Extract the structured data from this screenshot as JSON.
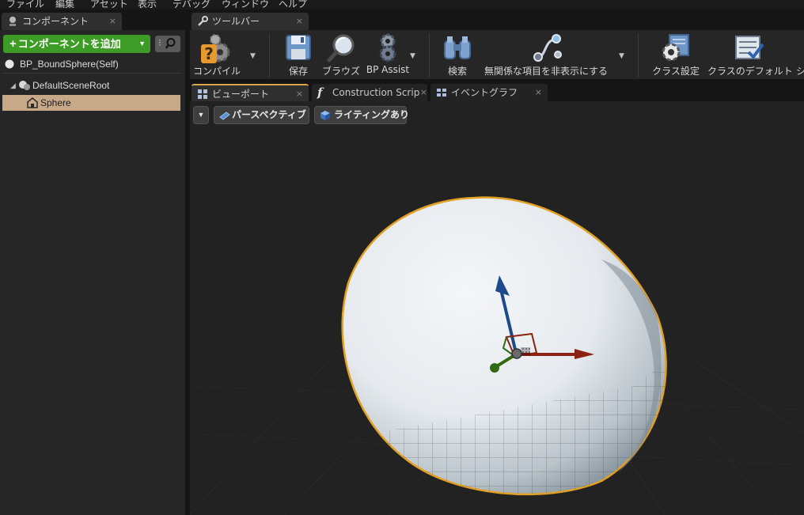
{
  "menu": [
    "ファイル",
    "編集",
    "アセット",
    "表示",
    "デバッグ",
    "ウィンドウ",
    "ヘルプ"
  ],
  "components_panel": {
    "tab_title": "コンポーネント",
    "tab_close": "×",
    "add_button_label": "コンポーネントを追加",
    "add_button_plus": "+",
    "tree": {
      "self": "BP_BoundSphere(Self)",
      "root": "DefaultSceneRoot",
      "sphere": "Sphere"
    }
  },
  "toolbar_panel": {
    "tab_title": "ツールバー",
    "tab_close": "×",
    "buttons": {
      "compile": "コンパイル",
      "save": "保存",
      "browse": "ブラウズ",
      "bp_assist": "BP Assist",
      "search": "検索",
      "hide_unrelated": "無関係な項目を非表示にする",
      "class_settings": "クラス設定",
      "class_defaults": "クラスのデフォルト",
      "simulation": "シ"
    }
  },
  "editor_tabs": [
    {
      "label": "ビューポート",
      "close": "×"
    },
    {
      "label": "Construction Scrip",
      "close": "×"
    },
    {
      "label": "イベントグラフ",
      "close": "×"
    }
  ],
  "viewport": {
    "perspective_label": "パースペクティブ",
    "lighting_label": "ライティングあり"
  },
  "colors": {
    "accent_green": "#3d9c25",
    "selection": "#c8a987",
    "outline": "#e2a024",
    "gizmo_x": "#8b2212",
    "gizmo_y": "#2f6a12",
    "gizmo_z": "#1d4a8a"
  },
  "icons": {
    "compile": "compile-question-gear-icon",
    "save": "floppy-save-icon",
    "browse": "magnifier-browse-icon",
    "bp_assist": "gear-stack-icon",
    "search": "binoculars-icon",
    "hide_unrelated": "node-graph-icon",
    "class_settings": "gear-document-icon",
    "class_defaults": "checklist-icon"
  }
}
